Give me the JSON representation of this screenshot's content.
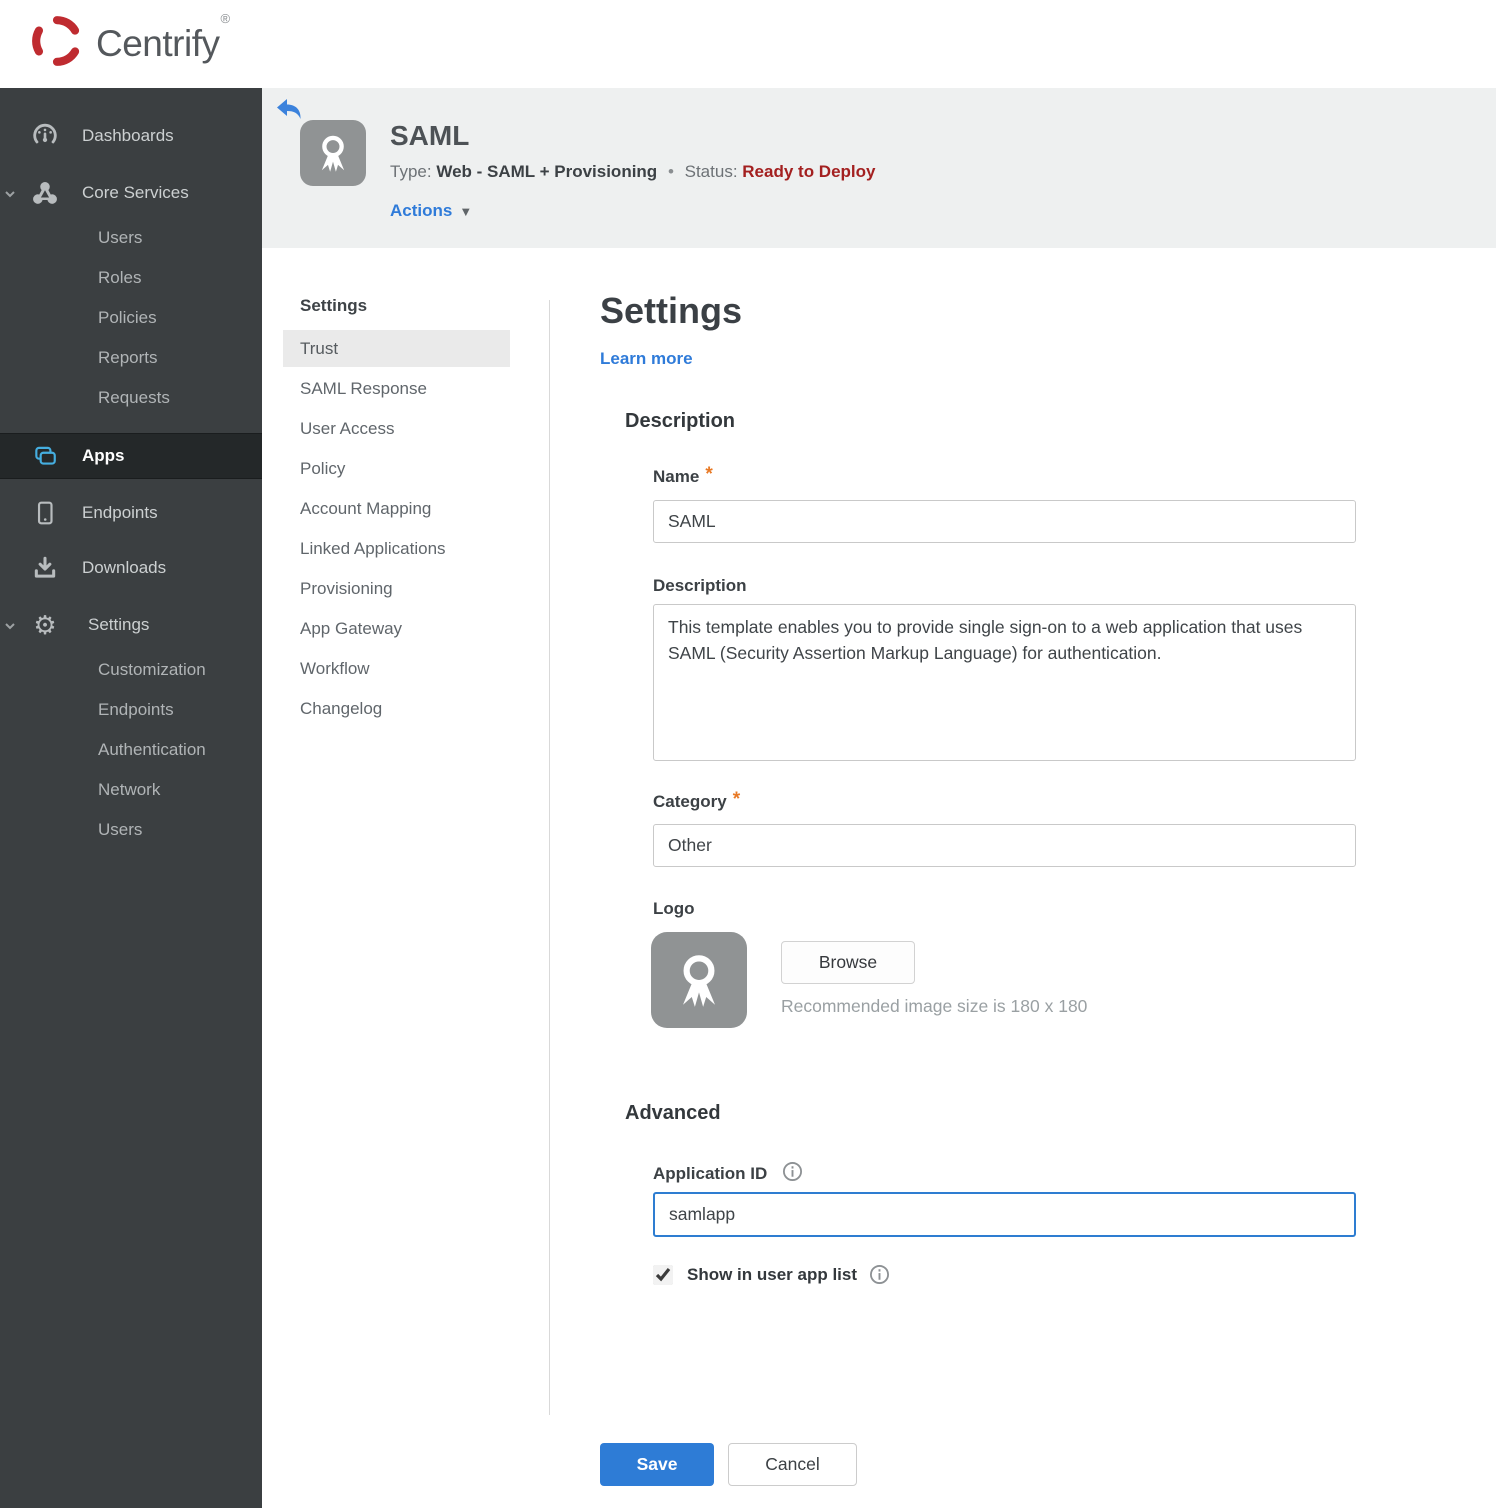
{
  "brand": {
    "name": "Centrify",
    "reg_mark": "®",
    "logo_color": "#bf2b30"
  },
  "sidebar": {
    "dashboards": {
      "label": "Dashboards"
    },
    "core_services": {
      "label": "Core Services",
      "children": [
        "Users",
        "Roles",
        "Policies",
        "Reports",
        "Requests"
      ]
    },
    "apps": {
      "label": "Apps",
      "active": true
    },
    "endpoints": {
      "label": "Endpoints"
    },
    "downloads": {
      "label": "Downloads"
    },
    "settings": {
      "label": "Settings",
      "children": [
        "Customization",
        "Endpoints",
        "Authentication",
        "Network",
        "Users"
      ]
    }
  },
  "app_header": {
    "title": "SAML",
    "type_label": "Type:",
    "type_value": "Web - SAML + Provisioning",
    "separator": "•",
    "status_label": "Status:",
    "status_value": "Ready to Deploy",
    "status_color": "#a32020",
    "actions_label": "Actions",
    "actions_caret": "▼"
  },
  "subnav": {
    "header": "Settings",
    "active_item": "Trust",
    "items": [
      "Trust",
      "SAML Response",
      "User Access",
      "Policy",
      "Account Mapping",
      "Linked Applications",
      "Provisioning",
      "App Gateway",
      "Workflow",
      "Changelog"
    ]
  },
  "main": {
    "title": "Settings",
    "learn_more": "Learn more",
    "required_mark": "*",
    "description_section": {
      "heading": "Description",
      "name_label": "Name",
      "name_value": "SAML",
      "description_label": "Description",
      "description_value": "This template enables you to provide single sign-on to a web application that uses SAML (Security Assertion Markup Language) for authentication.",
      "category_label": "Category",
      "category_value": "Other",
      "logo_label": "Logo",
      "browse_label": "Browse",
      "logo_hint": "Recommended image size is 180 x 180"
    },
    "advanced_section": {
      "heading": "Advanced",
      "app_id_label": "Application ID",
      "app_id_value": "samlapp",
      "show_in_list_label": "Show in user app list",
      "checkbox_checked": true
    },
    "footer": {
      "save_label": "Save",
      "cancel_label": "Cancel"
    }
  },
  "colors": {
    "accent_blue": "#2f7bd9",
    "save_blue": "#2e7cd6",
    "sidebar_bg": "#3b3f41",
    "band_bg": "#eef0f0",
    "app_icon_bg": "#909394"
  }
}
